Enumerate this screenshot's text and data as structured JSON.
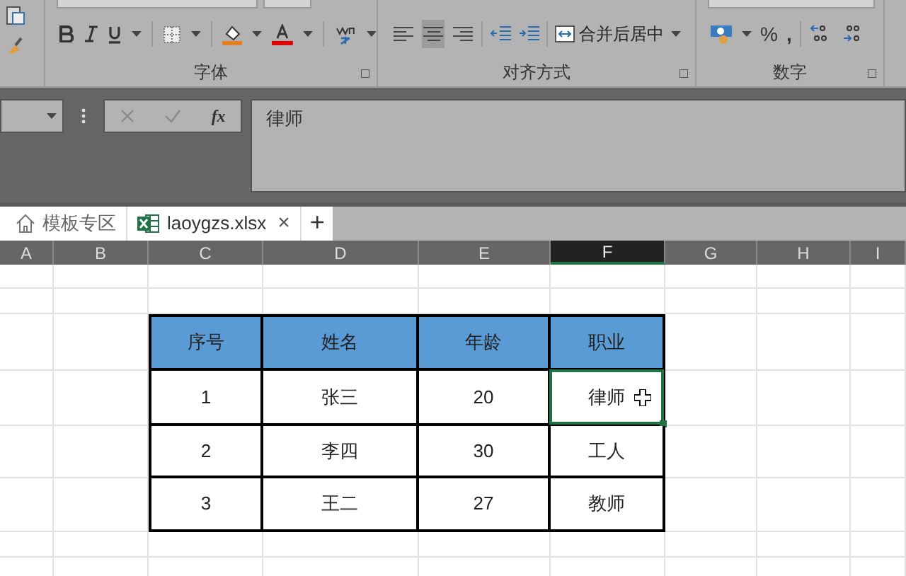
{
  "ribbon": {
    "groups": [
      {
        "label": "字体"
      },
      {
        "label": "对齐方式"
      },
      {
        "label": "数字"
      }
    ],
    "merge_button": "合并后居中",
    "number_buttons": [
      "%",
      ","
    ]
  },
  "formula_bar": {
    "fx": "fx",
    "value": "律师"
  },
  "tabs": [
    {
      "kind": "home",
      "label": "模板专区",
      "selected": false
    },
    {
      "kind": "file",
      "label": "laoygzs.xlsx",
      "selected": true,
      "close": "×"
    }
  ],
  "new_tab": "+",
  "columns": [
    {
      "label": "A",
      "selected": false
    },
    {
      "label": "B",
      "selected": false
    },
    {
      "label": "C",
      "selected": false
    },
    {
      "label": "D",
      "selected": false
    },
    {
      "label": "E",
      "selected": false
    },
    {
      "label": "F",
      "selected": true
    },
    {
      "label": "G",
      "selected": false
    },
    {
      "label": "H",
      "selected": false
    },
    {
      "label": "I",
      "selected": false
    }
  ],
  "table": {
    "header": [
      "序号",
      "姓名",
      "年龄",
      "职业"
    ],
    "rows": [
      [
        {
          "text": "1",
          "selected": false
        },
        {
          "text": "张三",
          "selected": false
        },
        {
          "text": "20",
          "selected": false
        },
        {
          "text": "律师",
          "selected": true
        }
      ],
      [
        {
          "text": "2",
          "selected": false
        },
        {
          "text": "李四",
          "selected": false
        },
        {
          "text": "30",
          "selected": false
        },
        {
          "text": "工人",
          "selected": false
        }
      ],
      [
        {
          "text": "3",
          "selected": false
        },
        {
          "text": "王二",
          "selected": false
        },
        {
          "text": "27",
          "selected": false
        },
        {
          "text": "教师",
          "selected": false
        }
      ]
    ]
  }
}
